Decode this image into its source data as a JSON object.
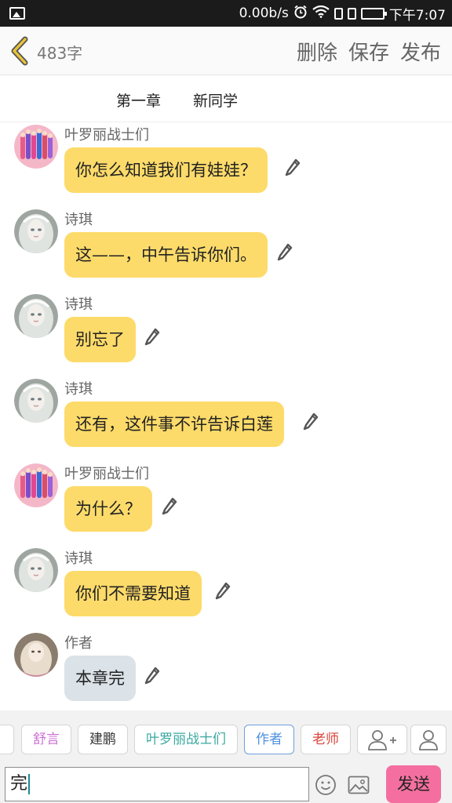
{
  "status_bar": {
    "speed": "0.00b/s",
    "time": "下午7:07",
    "icons": [
      "image-icon",
      "alarm-icon",
      "wifi-icon",
      "sim-icon",
      "sim-icon",
      "battery-icon"
    ],
    "battery_color": "#2ee23a"
  },
  "toolbar": {
    "word_count": "483字",
    "delete_label": "删除",
    "save_label": "保存",
    "publish_label": "发布",
    "accent": "#e8c33a"
  },
  "chapter": {
    "number": "第一章",
    "title": "新同学"
  },
  "messages": [
    {
      "sender": "叶罗丽战士们",
      "text": "你怎么知道我们有娃娃？",
      "bubble": "yellow",
      "avatar": "group-avatar"
    },
    {
      "sender": "诗琪",
      "text": "这——，中午告诉你们。",
      "bubble": "yellow",
      "avatar": "doll-avatar"
    },
    {
      "sender": "诗琪",
      "text": "别忘了",
      "bubble": "yellow",
      "avatar": "doll-avatar"
    },
    {
      "sender": "诗琪",
      "text": "还有，这件事不许告诉白莲",
      "bubble": "yellow",
      "avatar": "doll-avatar"
    },
    {
      "sender": "叶罗丽战士们",
      "text": "为什么？",
      "bubble": "yellow",
      "avatar": "group-avatar"
    },
    {
      "sender": "诗琪",
      "text": "你们不需要知道",
      "bubble": "yellow",
      "avatar": "doll-avatar"
    },
    {
      "sender": "作者",
      "text": "本章完",
      "bubble": "grey",
      "avatar": "author-avatar"
    }
  ],
  "roles": [
    {
      "label": "舒言",
      "color": "#cc6fd6"
    },
    {
      "label": "建鹏",
      "color": "#333333"
    },
    {
      "label": "叶罗丽战士们",
      "color": "#3aa8a0"
    },
    {
      "label": "作者",
      "color": "#4d8fe0",
      "selected": true
    },
    {
      "label": "老师",
      "color": "#d9453a"
    }
  ],
  "input": {
    "value": "完",
    "send_label": "发送",
    "send_color": "#f46fa0"
  }
}
